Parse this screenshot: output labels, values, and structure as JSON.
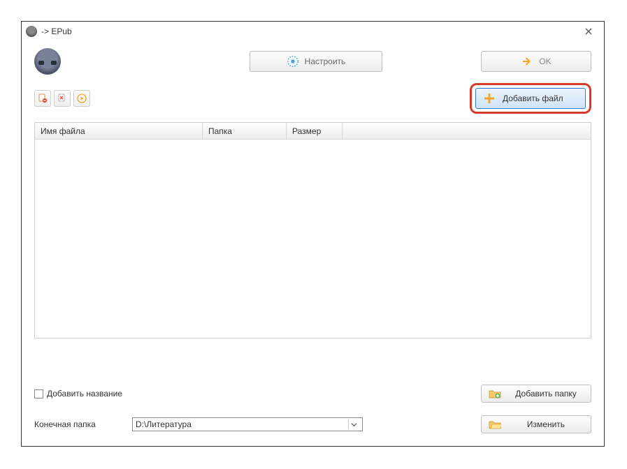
{
  "titlebar": {
    "title": "-> EPub"
  },
  "toolbar": {
    "configure_label": "Настроить",
    "ok_label": "OK",
    "addfile_label": "Добавить файл"
  },
  "table": {
    "headers": {
      "filename": "Имя файла",
      "folder": "Папка",
      "size": "Размер"
    },
    "rows": []
  },
  "bottom": {
    "add_title_label": "Добавить название",
    "add_folder_label": "Добавить папку",
    "dest_folder_label": "Конечная папка",
    "dest_folder_value": "D:\\Литература",
    "change_label": "Изменить"
  }
}
